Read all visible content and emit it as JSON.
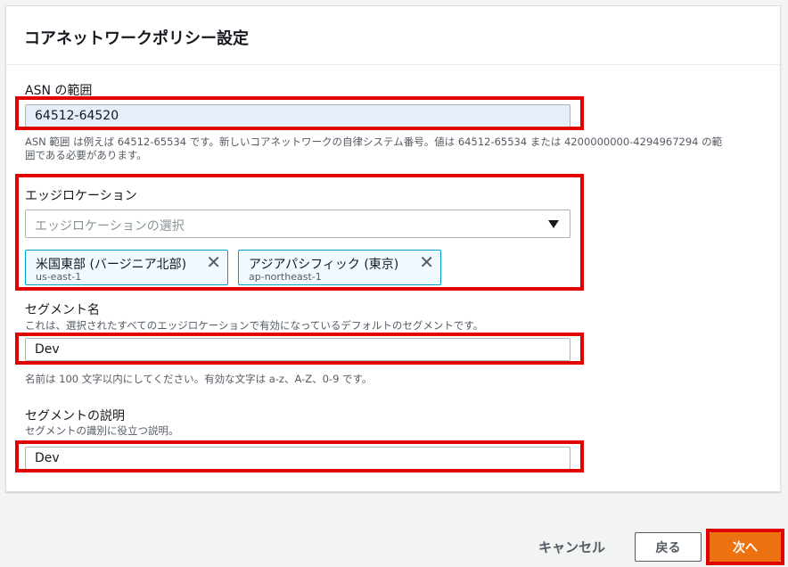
{
  "panel": {
    "title": "コアネットワークポリシー設定"
  },
  "asn": {
    "label": "ASN の範囲",
    "value": "64512-64520",
    "description": "ASN 範囲 は例えば 64512-65534 です。新しいコアネットワークの自律システム番号。値は 64512-65534 または 4200000000-4294967294 の範囲である必要があります。"
  },
  "edge": {
    "label": "エッジロケーション",
    "placeholder": "エッジロケーションの選択",
    "tokens": [
      {
        "label": "米国東部 (バージニア北部)",
        "sub": "us-east-1",
        "close": "✕"
      },
      {
        "label": "アジアパシフィック (東京)",
        "sub": "ap-northeast-1",
        "close": "✕"
      }
    ]
  },
  "segment_name": {
    "label": "セグメント名",
    "description": "これは、選択されたすべてのエッジロケーションで有効になっているデフォルトのセグメントです。",
    "value": "Dev",
    "hint": "名前は 100 文字以内にしてください。有効な文字は a-z、A-Z、0-9 です。"
  },
  "segment_desc": {
    "label": "セグメントの説明",
    "description": "セグメントの識別に役立つ説明。",
    "value": "Dev"
  },
  "footer": {
    "cancel": "キャンセル",
    "back": "戻る",
    "next": "次へ"
  },
  "colors": {
    "highlight": "#e00000",
    "primary": "#ec7211",
    "token_border": "#00a1c9"
  }
}
